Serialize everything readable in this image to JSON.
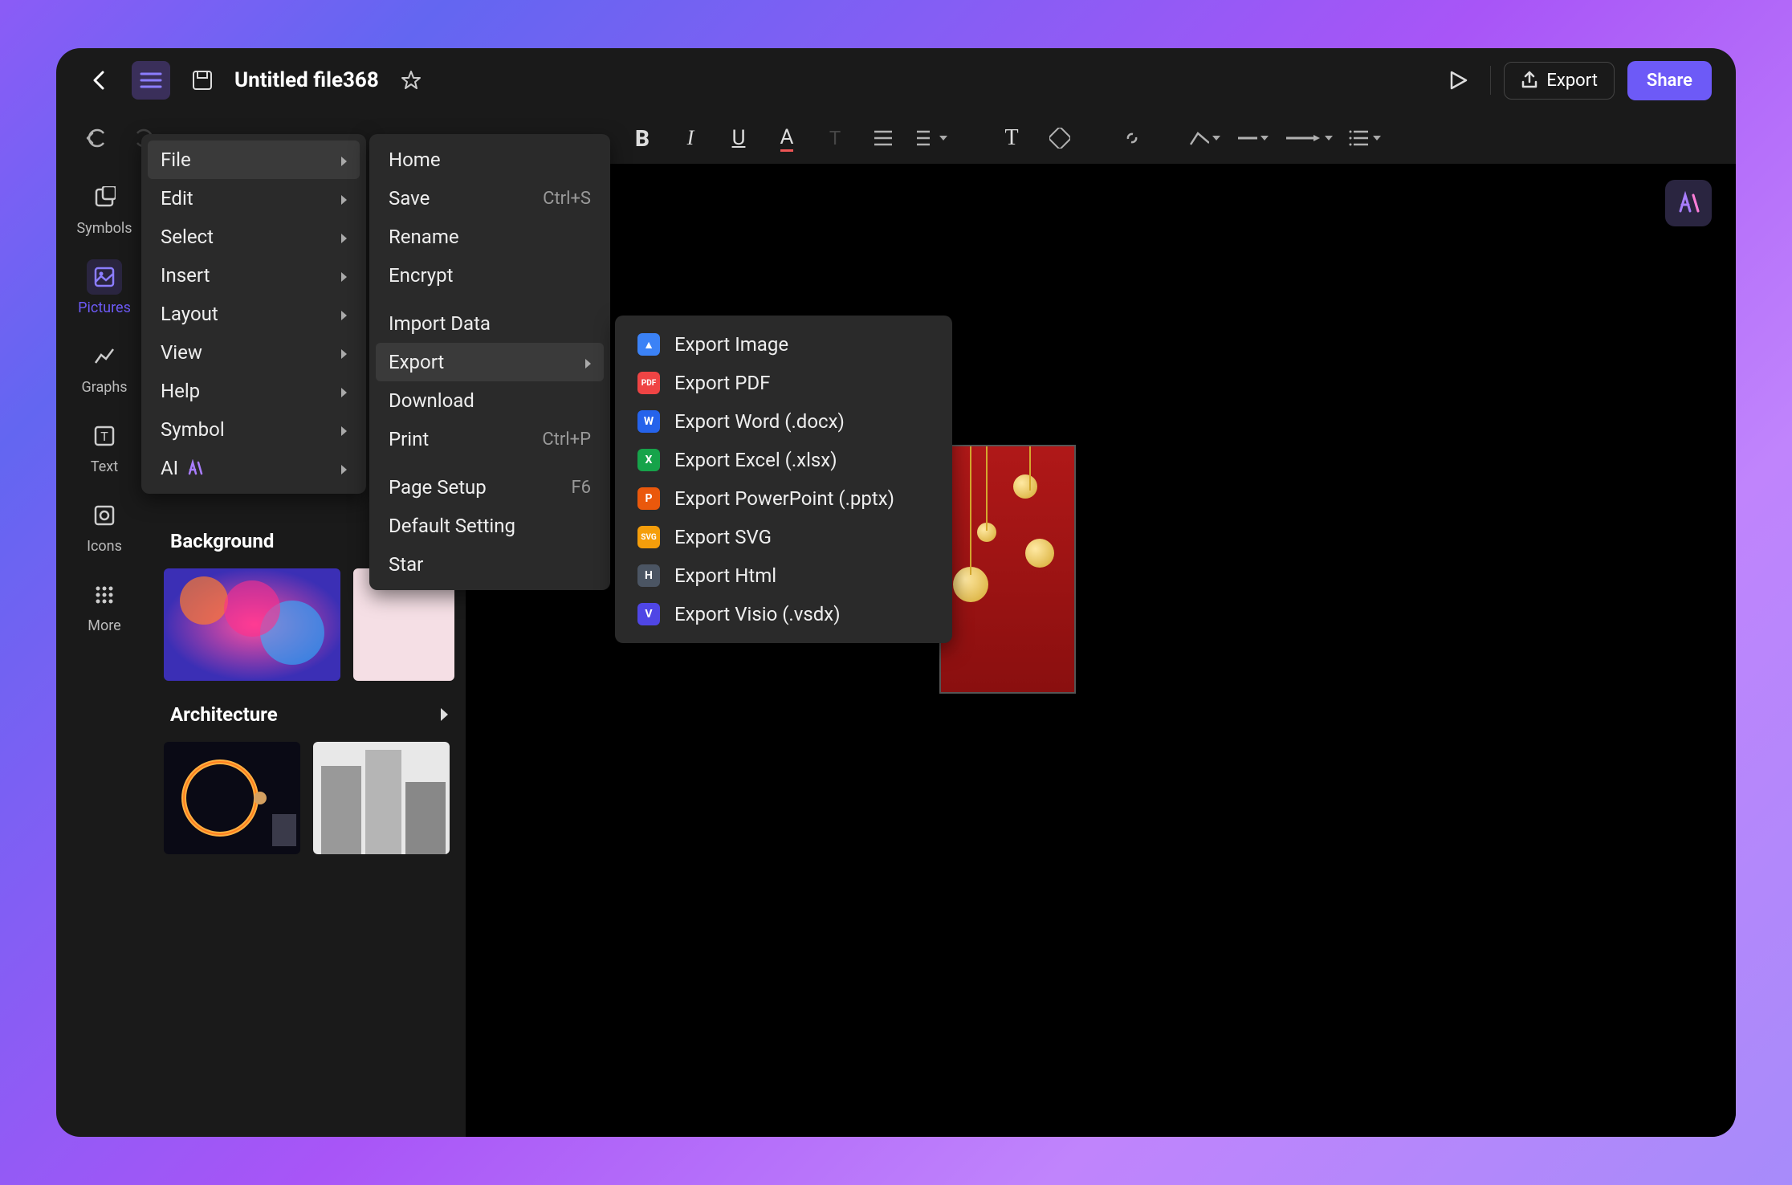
{
  "title": "Untitled file368",
  "header": {
    "export": "Export",
    "share": "Share"
  },
  "sidebar": [
    {
      "label": "Symbols"
    },
    {
      "label": "Pictures"
    },
    {
      "label": "Graphs"
    },
    {
      "label": "Text"
    },
    {
      "label": "Icons"
    },
    {
      "label": "More"
    }
  ],
  "panel": {
    "background_label": "Background",
    "architecture_label": "Architecture"
  },
  "mainmenu": [
    {
      "label": "File"
    },
    {
      "label": "Edit"
    },
    {
      "label": "Select"
    },
    {
      "label": "Insert"
    },
    {
      "label": "Layout"
    },
    {
      "label": "View"
    },
    {
      "label": "Help"
    },
    {
      "label": "Symbol"
    },
    {
      "label": "AI"
    }
  ],
  "filemenu": {
    "home": "Home",
    "save": "Save",
    "save_shortcut": "Ctrl+S",
    "rename": "Rename",
    "encrypt": "Encrypt",
    "import": "Import Data",
    "export": "Export",
    "download": "Download",
    "print": "Print",
    "print_shortcut": "Ctrl+P",
    "pagesetup": "Page Setup",
    "pagesetup_shortcut": "F6",
    "default": "Default Setting",
    "star": "Star"
  },
  "exportmenu": [
    {
      "label": "Export Image",
      "badge": "▲",
      "cls": "fmt-blue"
    },
    {
      "label": "Export PDF",
      "badge": "PDF",
      "cls": "fmt-red"
    },
    {
      "label": "Export Word (.docx)",
      "badge": "W",
      "cls": "fmt-word"
    },
    {
      "label": "Export Excel (.xlsx)",
      "badge": "X",
      "cls": "fmt-excel"
    },
    {
      "label": "Export PowerPoint (.pptx)",
      "badge": "P",
      "cls": "fmt-ppt"
    },
    {
      "label": "Export SVG",
      "badge": "SVG",
      "cls": "fmt-orange"
    },
    {
      "label": "Export Html",
      "badge": "H",
      "cls": "fmt-gray"
    },
    {
      "label": "Export Visio (.vsdx)",
      "badge": "V",
      "cls": "fmt-violet"
    }
  ]
}
